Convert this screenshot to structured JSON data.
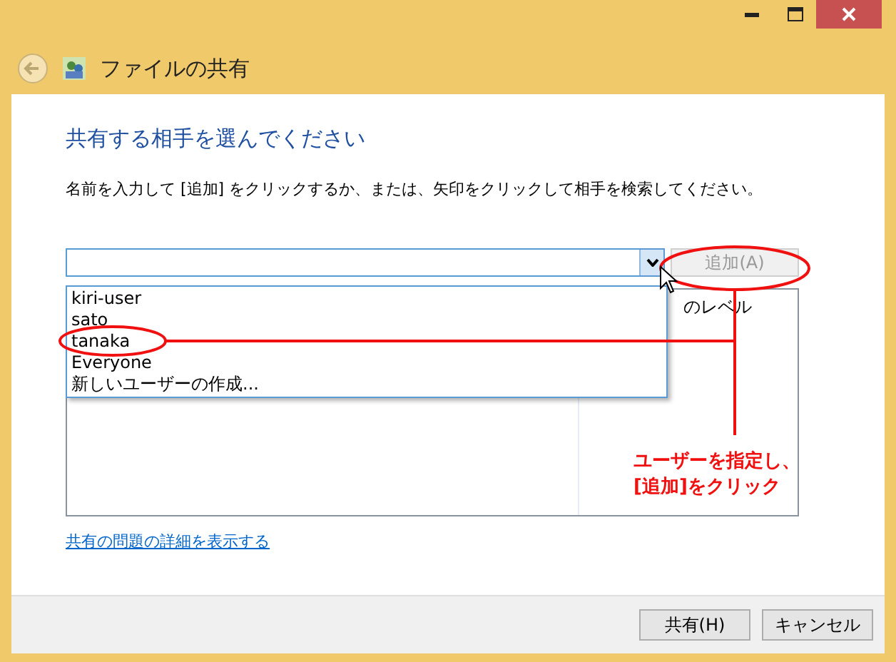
{
  "window": {
    "title": "ファイルの共有"
  },
  "heading": "共有する相手を選んでください",
  "instruction": "名前を入力して [追加] をクリックするか、または、矢印をクリックして相手を検索してください。",
  "add_button": {
    "label": "追加(A)",
    "disabled": true
  },
  "dropdown_items": [
    "kiri-user",
    "sato",
    "tanaka",
    "Everyone",
    "新しいユーザーの作成..."
  ],
  "table": {
    "columns": [
      "のレベル"
    ]
  },
  "annotation": {
    "lines": [
      "ユーザーを指定し、",
      "[追加]をクリック"
    ]
  },
  "link": "共有の問題の詳細を表示する",
  "buttons": [
    "共有(H)",
    "キャンセル"
  ]
}
